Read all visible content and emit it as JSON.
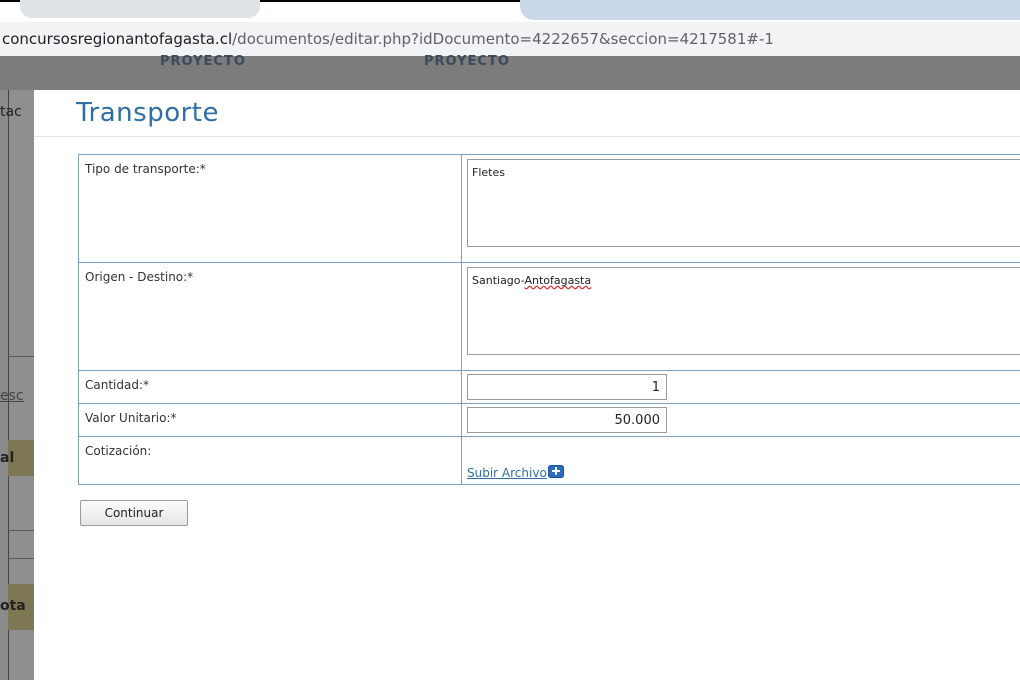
{
  "browser": {
    "url_host": "concursosregionantofagasta.cl",
    "url_path": "/documentos/editar.php?idDocumento=4222657&seccion=4217581#-1"
  },
  "background": {
    "header_left": "PROYECTO",
    "header_right": "PROYECTO",
    "fragments": [
      "tac",
      "esc",
      "al",
      "ota"
    ]
  },
  "modal": {
    "title": "Transporte",
    "fields": {
      "tipo_label": "Tipo de transporte:*",
      "tipo_value": "Fletes",
      "origen_label": "Origen - Destino:*",
      "origen_value_prefix": "Santiago-",
      "origen_value_word": "Antofagasta",
      "cantidad_label": "Cantidad:*",
      "cantidad_value": "1",
      "valor_label": "Valor Unitario:*",
      "valor_value": "50.000",
      "cotizacion_label": "Cotización:",
      "upload_link": "Subir Archivo"
    },
    "continue_button": "Continuar"
  },
  "colors": {
    "title": "#2f6fa8",
    "table_border": "#7d9fc0",
    "link": "#2f6fa8",
    "upload_icon": "#2b6cc4"
  }
}
